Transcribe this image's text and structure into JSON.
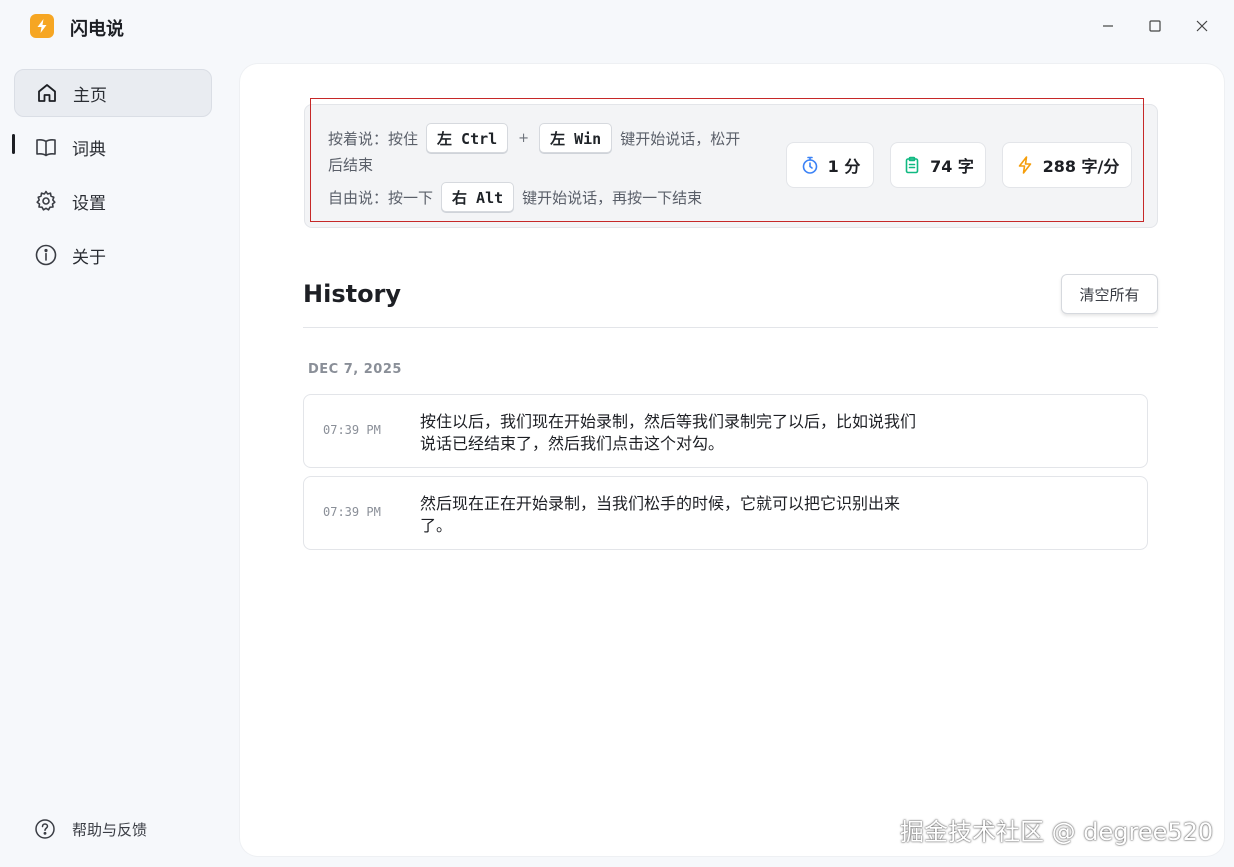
{
  "app": {
    "title": "闪电说"
  },
  "window_controls": [
    "minimize-icon",
    "maximize-icon",
    "close-icon"
  ],
  "sidebar": {
    "items": [
      {
        "label": "主页",
        "icon": "home-icon",
        "active": true
      },
      {
        "label": "词典",
        "icon": "book-icon",
        "active": false
      },
      {
        "label": "设置",
        "icon": "gear-icon",
        "active": false
      },
      {
        "label": "关于",
        "icon": "info-icon",
        "active": false
      }
    ],
    "help": {
      "label": "帮助与反馈",
      "icon": "help-icon"
    }
  },
  "hints": {
    "hold": {
      "prefix": "按着说：按住",
      "key1": "左 Ctrl",
      "plus": "+",
      "key2": "左 Win",
      "suffix1": "键开始说话，松开",
      "suffix2": "后结束"
    },
    "toggle": {
      "prefix": "自由说：按一下",
      "key": "右 Alt",
      "suffix": "键开始说话，再按一下结束"
    }
  },
  "stats": {
    "duration": {
      "value": "1 分",
      "icon": "timer-icon",
      "color": "#3b82f6"
    },
    "chars": {
      "value": "74 字",
      "icon": "clipboard-icon",
      "color": "#10b981"
    },
    "speed": {
      "value": "288 字/分",
      "icon": "lightning-icon",
      "color": "#f59e0b"
    }
  },
  "history": {
    "title": "History",
    "clear_label": "清空所有",
    "groups": [
      {
        "date": "DEC 7, 2025",
        "items": [
          {
            "time": "07:39 PM",
            "line1": "按住以后，我们现在开始录制，然后等我们录制完了以后，比如说我们",
            "line2": "说话已经结束了，然后我们点击这个对勾。"
          },
          {
            "time": "07:39 PM",
            "line1": "然后现在正在开始录制，当我们松手的时候，它就可以把它识别出来",
            "line2": "了。"
          }
        ]
      }
    ]
  },
  "watermark": "掘金技术社区 @ degree520"
}
